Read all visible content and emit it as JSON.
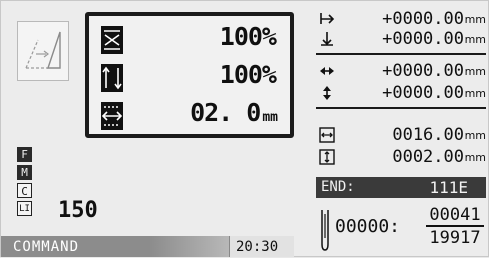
{
  "scale_panel": {
    "x_scale": {
      "icon": "horizontal-scale-icon",
      "value": "100%",
      "unit": ""
    },
    "y_scale": {
      "icon": "vertical-scale-icon",
      "value": "100%",
      "unit": ""
    },
    "width": {
      "icon": "width-icon",
      "value": "02. 0",
      "unit": "mm"
    }
  },
  "status_indicators": [
    {
      "letter": "F",
      "style": "filled"
    },
    {
      "letter": "M",
      "style": "filled"
    },
    {
      "letter": "C",
      "style": "outlined"
    },
    {
      "letter": "LI",
      "style": "outlined"
    }
  ],
  "count_value": "150",
  "command_bar": {
    "label": "COMMAND"
  },
  "clock": "20:30",
  "offsets": [
    {
      "icon": "x-offset-icon",
      "value": "+0000.00",
      "unit": "mm"
    },
    {
      "icon": "y-offset-icon",
      "value": "+0000.00",
      "unit": "mm"
    },
    {
      "icon": "x-move-icon",
      "value": "+0000.00",
      "unit": "mm"
    },
    {
      "icon": "y-move-icon",
      "value": "+0000.00",
      "unit": "mm"
    },
    {
      "icon": "width-size-icon",
      "value": "0016.00",
      "unit": "mm"
    },
    {
      "icon": "height-size-icon",
      "value": "0002.00",
      "unit": "mm"
    }
  ],
  "end": {
    "label": "END:",
    "value": "111E"
  },
  "stitch": {
    "prefix": "00000:",
    "current": "00041",
    "total": "19917"
  },
  "colors": {
    "panel_border": "#1b1b1b",
    "command_bar": "#8c8c8c",
    "end_bar": "#3a3a3a"
  }
}
